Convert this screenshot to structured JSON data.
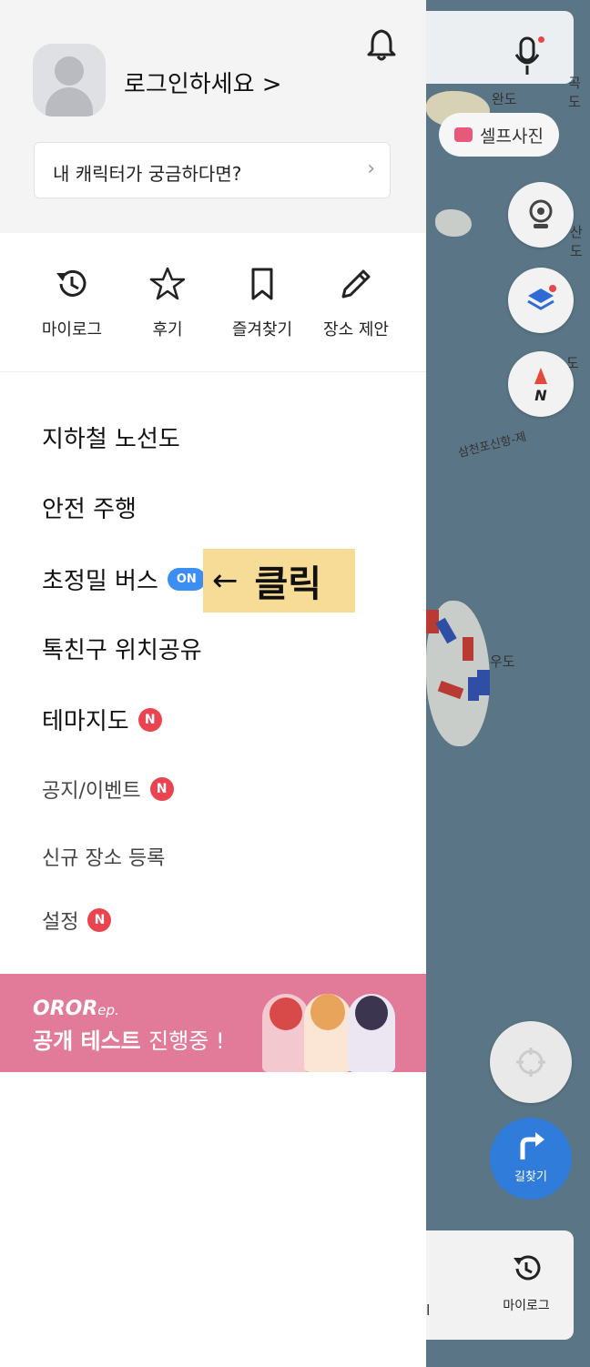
{
  "profile": {
    "login_text": "로그인하세요 >",
    "character_prompt": "내 캐릭터가 궁금하다면?",
    "chevron": "›"
  },
  "quick_actions": [
    {
      "label": "마이로그",
      "icon": "history-icon"
    },
    {
      "label": "후기",
      "icon": "star-icon"
    },
    {
      "label": "즐겨찾기",
      "icon": "bookmark-icon"
    },
    {
      "label": "장소 제안",
      "icon": "pencil-icon"
    }
  ],
  "menu": {
    "subway": "지하철 노선도",
    "safe_drive": "안전 주행",
    "precise_bus": "초정밀 버스",
    "precise_bus_badge": "ON",
    "friend_location": "톡친구 위치공유",
    "theme_map": "테마지도",
    "notice": "공지/이벤트",
    "new_place": "신규 장소 등록",
    "settings": "설정",
    "new_badge": "N"
  },
  "callout": {
    "arrow": "←",
    "text": "클릭"
  },
  "banner": {
    "brand": "OROR",
    "brand_suffix": "ep.",
    "caption_bold": "공개 테스트",
    "caption_rest": "진행중 !"
  },
  "map": {
    "labels": [
      "완도",
      "산도",
      "도",
      "삼천포신항-제",
      "우도",
      "곡도"
    ],
    "selfie": "셀프사진",
    "route": "길찾기",
    "mylog": "마이로그",
    "bottom_partial": "l"
  },
  "colors": {
    "accent_blue": "#3d8ef3",
    "badge_red": "#e94450",
    "banner_pink": "#e27b9a",
    "callout_yellow": "#f6dc96",
    "sea": "#5a7585"
  }
}
